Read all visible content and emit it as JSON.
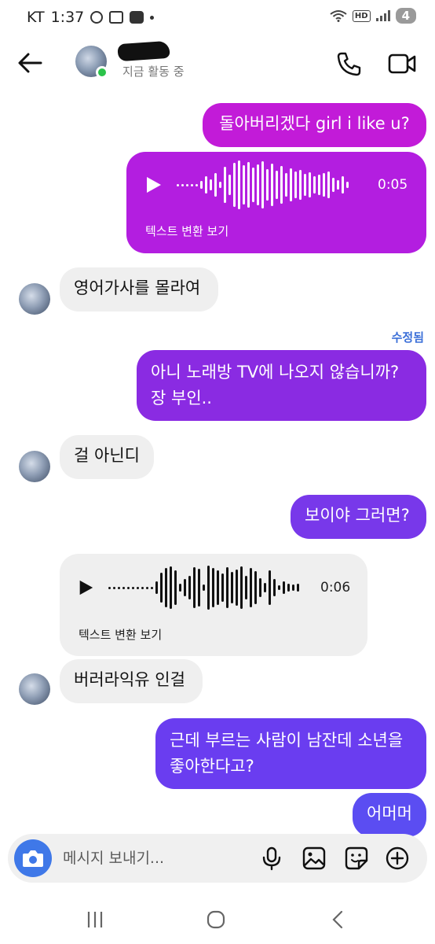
{
  "status_bar": {
    "carrier": "KT",
    "time": "1:37",
    "battery": "4",
    "network_badge": "HD"
  },
  "header": {
    "status_text": "지금 활동 중",
    "status_color": "#2bc34a"
  },
  "messages": {
    "m1": "돌아버리겠다 girl i like u?",
    "voice1": {
      "duration": "0:05",
      "transcript_link": "텍스트 변환 보기"
    },
    "m2": "영어가사를 몰라여",
    "edited_label": "수정됨",
    "m3_line1": "아니 노래방 TV에 나오지 않습니까?",
    "m3_line2": "장 부인..",
    "m4": "걸 아닌디",
    "m5": "보이야 그러면?",
    "voice2": {
      "duration": "0:06",
      "transcript_link": "텍스트 변환 보기"
    },
    "m6": "버러라익유 인걸",
    "m7_line1": "근데 부르는 사람이 남잔데 소년을",
    "m7_line2": "좋아한다고?",
    "m8": "어머머"
  },
  "composer": {
    "placeholder": "메시지 보내기..."
  },
  "colors": {
    "out_magenta": "#c21bd8",
    "out_purple": "#8a2be2",
    "out_violet": "#6a3df0",
    "out_indigo": "#5b4df2",
    "in_bubble": "#efefef",
    "accent_blue": "#3f78e8"
  },
  "icons": [
    "back-arrow-icon",
    "phone-icon",
    "video-camera-icon",
    "play-icon",
    "camera-icon",
    "microphone-icon",
    "gallery-icon",
    "sticker-icon",
    "plus-icon",
    "recent-apps-icon",
    "home-icon",
    "back-nav-icon"
  ]
}
